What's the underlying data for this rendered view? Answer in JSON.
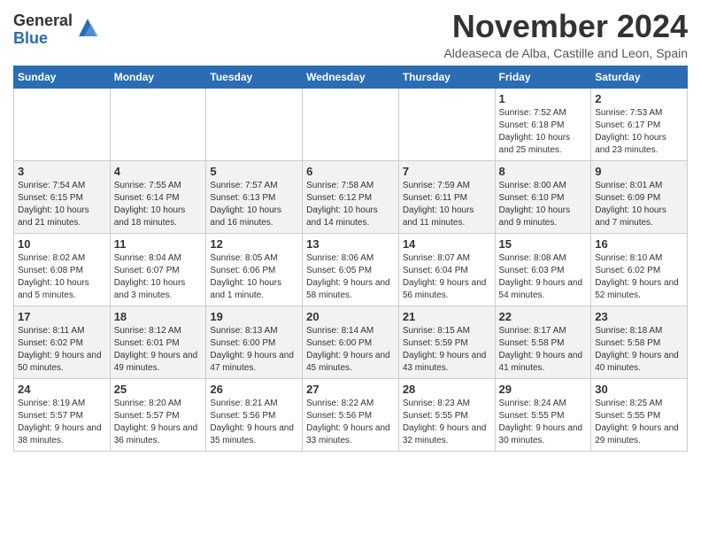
{
  "header": {
    "logo_general": "General",
    "logo_blue": "Blue",
    "month_title": "November 2024",
    "location": "Aldeaseca de Alba, Castille and Leon, Spain"
  },
  "weekdays": [
    "Sunday",
    "Monday",
    "Tuesday",
    "Wednesday",
    "Thursday",
    "Friday",
    "Saturday"
  ],
  "weeks": [
    [
      {
        "day": "",
        "content": ""
      },
      {
        "day": "",
        "content": ""
      },
      {
        "day": "",
        "content": ""
      },
      {
        "day": "",
        "content": ""
      },
      {
        "day": "",
        "content": ""
      },
      {
        "day": "1",
        "content": "Sunrise: 7:52 AM\nSunset: 6:18 PM\nDaylight: 10 hours and 25 minutes."
      },
      {
        "day": "2",
        "content": "Sunrise: 7:53 AM\nSunset: 6:17 PM\nDaylight: 10 hours and 23 minutes."
      }
    ],
    [
      {
        "day": "3",
        "content": "Sunrise: 7:54 AM\nSunset: 6:15 PM\nDaylight: 10 hours and 21 minutes."
      },
      {
        "day": "4",
        "content": "Sunrise: 7:55 AM\nSunset: 6:14 PM\nDaylight: 10 hours and 18 minutes."
      },
      {
        "day": "5",
        "content": "Sunrise: 7:57 AM\nSunset: 6:13 PM\nDaylight: 10 hours and 16 minutes."
      },
      {
        "day": "6",
        "content": "Sunrise: 7:58 AM\nSunset: 6:12 PM\nDaylight: 10 hours and 14 minutes."
      },
      {
        "day": "7",
        "content": "Sunrise: 7:59 AM\nSunset: 6:11 PM\nDaylight: 10 hours and 11 minutes."
      },
      {
        "day": "8",
        "content": "Sunrise: 8:00 AM\nSunset: 6:10 PM\nDaylight: 10 hours and 9 minutes."
      },
      {
        "day": "9",
        "content": "Sunrise: 8:01 AM\nSunset: 6:09 PM\nDaylight: 10 hours and 7 minutes."
      }
    ],
    [
      {
        "day": "10",
        "content": "Sunrise: 8:02 AM\nSunset: 6:08 PM\nDaylight: 10 hours and 5 minutes."
      },
      {
        "day": "11",
        "content": "Sunrise: 8:04 AM\nSunset: 6:07 PM\nDaylight: 10 hours and 3 minutes."
      },
      {
        "day": "12",
        "content": "Sunrise: 8:05 AM\nSunset: 6:06 PM\nDaylight: 10 hours and 1 minute."
      },
      {
        "day": "13",
        "content": "Sunrise: 8:06 AM\nSunset: 6:05 PM\nDaylight: 9 hours and 58 minutes."
      },
      {
        "day": "14",
        "content": "Sunrise: 8:07 AM\nSunset: 6:04 PM\nDaylight: 9 hours and 56 minutes."
      },
      {
        "day": "15",
        "content": "Sunrise: 8:08 AM\nSunset: 6:03 PM\nDaylight: 9 hours and 54 minutes."
      },
      {
        "day": "16",
        "content": "Sunrise: 8:10 AM\nSunset: 6:02 PM\nDaylight: 9 hours and 52 minutes."
      }
    ],
    [
      {
        "day": "17",
        "content": "Sunrise: 8:11 AM\nSunset: 6:02 PM\nDaylight: 9 hours and 50 minutes."
      },
      {
        "day": "18",
        "content": "Sunrise: 8:12 AM\nSunset: 6:01 PM\nDaylight: 9 hours and 49 minutes."
      },
      {
        "day": "19",
        "content": "Sunrise: 8:13 AM\nSunset: 6:00 PM\nDaylight: 9 hours and 47 minutes."
      },
      {
        "day": "20",
        "content": "Sunrise: 8:14 AM\nSunset: 6:00 PM\nDaylight: 9 hours and 45 minutes."
      },
      {
        "day": "21",
        "content": "Sunrise: 8:15 AM\nSunset: 5:59 PM\nDaylight: 9 hours and 43 minutes."
      },
      {
        "day": "22",
        "content": "Sunrise: 8:17 AM\nSunset: 5:58 PM\nDaylight: 9 hours and 41 minutes."
      },
      {
        "day": "23",
        "content": "Sunrise: 8:18 AM\nSunset: 5:58 PM\nDaylight: 9 hours and 40 minutes."
      }
    ],
    [
      {
        "day": "24",
        "content": "Sunrise: 8:19 AM\nSunset: 5:57 PM\nDaylight: 9 hours and 38 minutes."
      },
      {
        "day": "25",
        "content": "Sunrise: 8:20 AM\nSunset: 5:57 PM\nDaylight: 9 hours and 36 minutes."
      },
      {
        "day": "26",
        "content": "Sunrise: 8:21 AM\nSunset: 5:56 PM\nDaylight: 9 hours and 35 minutes."
      },
      {
        "day": "27",
        "content": "Sunrise: 8:22 AM\nSunset: 5:56 PM\nDaylight: 9 hours and 33 minutes."
      },
      {
        "day": "28",
        "content": "Sunrise: 8:23 AM\nSunset: 5:55 PM\nDaylight: 9 hours and 32 minutes."
      },
      {
        "day": "29",
        "content": "Sunrise: 8:24 AM\nSunset: 5:55 PM\nDaylight: 9 hours and 30 minutes."
      },
      {
        "day": "30",
        "content": "Sunrise: 8:25 AM\nSunset: 5:55 PM\nDaylight: 9 hours and 29 minutes."
      }
    ]
  ]
}
